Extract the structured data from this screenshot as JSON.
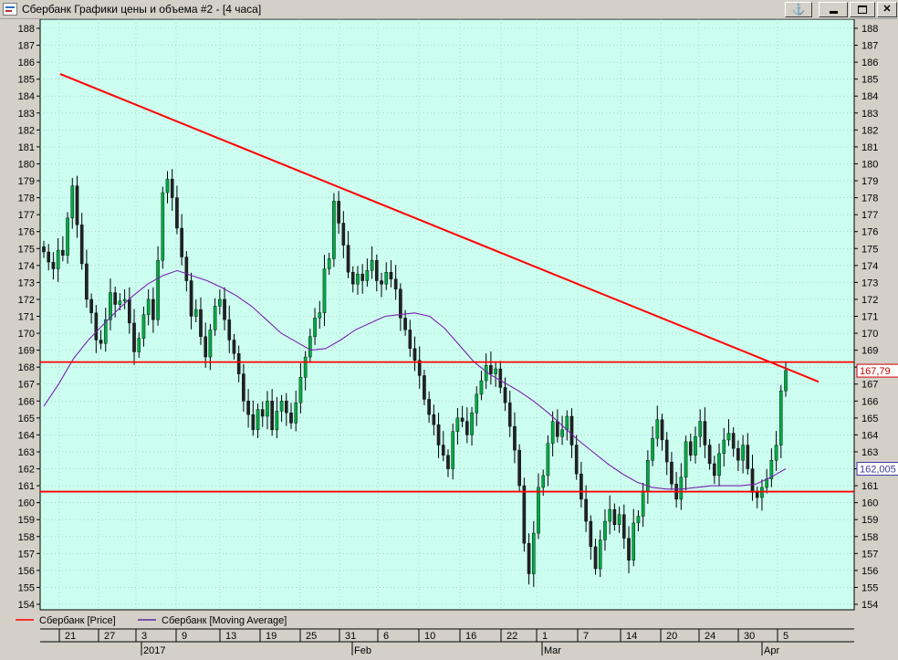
{
  "window": {
    "title": "Сбербанк Графики цены и объема #2 - [4 часа]",
    "anchor_icon": "anchor-icon",
    "minimize_icon": "minimize-icon",
    "maximize_icon": "maximize-icon",
    "close_icon": "close-icon"
  },
  "colors": {
    "plot_bg": "#ccfff0",
    "up_candle": "#00aa44",
    "down_candle": "#222222",
    "trend_line": "#ff0000",
    "moving_average": "#7a1fb0",
    "grid": "#9ab8b0"
  },
  "chart_data": {
    "type": "candlestick",
    "title": "",
    "ylim": [
      154,
      188
    ],
    "y_ticks": [
      154,
      155,
      156,
      157,
      158,
      159,
      160,
      161,
      162,
      163,
      164,
      165,
      166,
      167,
      168,
      169,
      170,
      171,
      172,
      173,
      174,
      175,
      176,
      177,
      178,
      179,
      180,
      181,
      182,
      183,
      184,
      185,
      186,
      187,
      188
    ],
    "x_day_labels": [
      "21",
      "27",
      "3",
      "9",
      "13",
      "19",
      "25",
      "31",
      "6",
      "10",
      "16",
      "22",
      "1",
      "7",
      "14",
      "20",
      "24",
      "30",
      "5"
    ],
    "x_month_labels": [
      "2017",
      "Feb",
      "Mar",
      "Apr"
    ],
    "price_badge": "167,79",
    "ma_badge": "162,005",
    "horizontal_lines": [
      168.3,
      160.65
    ],
    "trend_line": {
      "from": 185.3,
      "to": 168.0
    },
    "legend": [
      {
        "label": "Сбербанк [Price]",
        "color": "#ff0000"
      },
      {
        "label": "Сбербанк [Moving Average]",
        "color": "#5a2aa0"
      }
    ],
    "close_path": [
      174.8,
      174.2,
      173.8,
      174.9,
      174.6,
      176.8,
      178.7,
      176.4,
      174.1,
      172.0,
      171.2,
      169.6,
      169.4,
      170.8,
      172.4,
      171.7,
      171.9,
      172.0,
      170.6,
      168.9,
      169.7,
      171.1,
      172.0,
      170.8,
      174.3,
      178.3,
      179.1,
      178.0,
      176.2,
      174.5,
      173.1,
      171.0,
      171.4,
      169.8,
      168.6,
      170.2,
      171.6,
      172.0,
      170.8,
      169.6,
      168.8,
      167.6,
      166.0,
      165.2,
      164.3,
      165.5,
      165.1,
      166.0,
      164.3,
      165.4,
      166.0,
      165.3,
      164.7,
      165.9,
      167.4,
      168.6,
      169.8,
      170.9,
      171.2,
      173.8,
      174.4,
      177.8,
      176.5,
      175.2,
      173.6,
      172.9,
      173.5,
      173.1,
      173.7,
      174.3,
      173.1,
      172.9,
      173.6,
      173.2,
      172.6,
      170.9,
      170.2,
      169.1,
      168.4,
      167.5,
      166.1,
      165.2,
      164.6,
      163.4,
      162.8,
      162.0,
      164.2,
      165.0,
      164.8,
      164.0,
      165.3,
      166.4,
      167.2,
      168.1,
      167.6,
      167.9,
      166.8,
      165.9,
      164.5,
      163.1,
      161.0,
      157.6,
      155.8,
      158.2,
      160.9,
      161.6,
      163.5,
      164.8,
      163.9,
      164.3,
      165.1,
      163.4,
      161.7,
      160.2,
      158.9,
      157.4,
      156.1,
      157.8,
      158.9,
      159.6,
      158.7,
      159.3,
      157.9,
      156.6,
      158.8,
      159.2,
      160.7,
      162.5,
      163.8,
      164.9,
      163.7,
      162.4,
      161.1,
      160.2,
      161.5,
      163.6,
      162.8,
      163.9,
      164.8,
      163.4,
      162.3,
      161.6,
      162.9,
      163.7,
      164.1,
      163.2,
      162.5,
      163.4,
      162.0,
      160.6,
      160.3,
      160.9,
      161.4,
      162.5,
      163.4,
      166.6,
      167.8
    ],
    "ma_path": [
      165.7,
      167.0,
      168.5,
      169.6,
      170.5,
      171.4,
      172.2,
      172.9,
      173.4,
      173.7,
      173.4,
      173.1,
      172.7,
      172.2,
      171.6,
      170.8,
      170.0,
      169.5,
      169.0,
      169.1,
      169.6,
      170.2,
      170.6,
      171.0,
      171.1,
      171.2,
      171.0,
      170.3,
      169.3,
      168.3,
      167.6,
      167.1,
      166.6,
      166.0,
      165.3,
      164.5,
      163.7,
      163.0,
      162.3,
      161.7,
      161.2,
      160.9,
      160.8,
      160.8,
      160.9,
      161.0,
      161.0,
      161.0,
      161.1,
      161.5,
      162.0
    ]
  }
}
